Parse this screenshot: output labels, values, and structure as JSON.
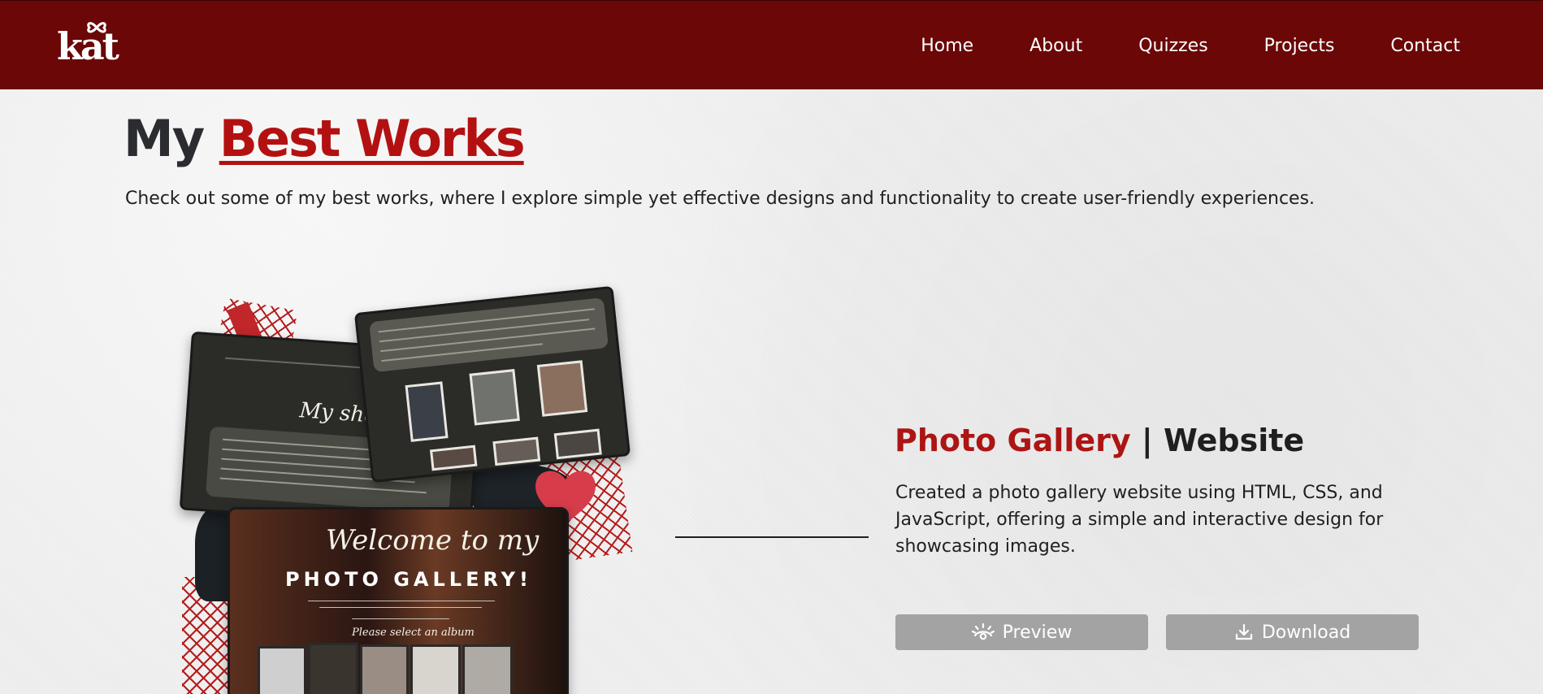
{
  "nav": {
    "logo": "kat",
    "links": [
      "Home",
      "About",
      "Quizzes",
      "Projects",
      "Contact"
    ]
  },
  "hero": {
    "title_plain": "My",
    "title_accent": "Best Works",
    "intro": "Check out some of my best works, where I explore simple yet effective designs and functionality to create user-friendly experiences."
  },
  "project": {
    "name": "Photo Gallery",
    "separator": "|",
    "type": "Website",
    "description": "Created a photo gallery website using HTML, CSS, and JavaScript, offering a simple and interactive design for showcasing images.",
    "buttons": {
      "preview": "Preview",
      "download": "Download"
    },
    "collage": {
      "welcome_text": "Welcome to my",
      "gallery_text": "PHOTO GALLERY!",
      "album_text": "Please select an album",
      "story_text": "My short st"
    }
  },
  "colors": {
    "nav_bg": "#6b0707",
    "accent_red": "#b31111",
    "button_gray": "#a3a3a3",
    "text_dark": "#1f1f1f"
  },
  "icons": {
    "preview": "eye-icon",
    "download": "download-icon"
  }
}
